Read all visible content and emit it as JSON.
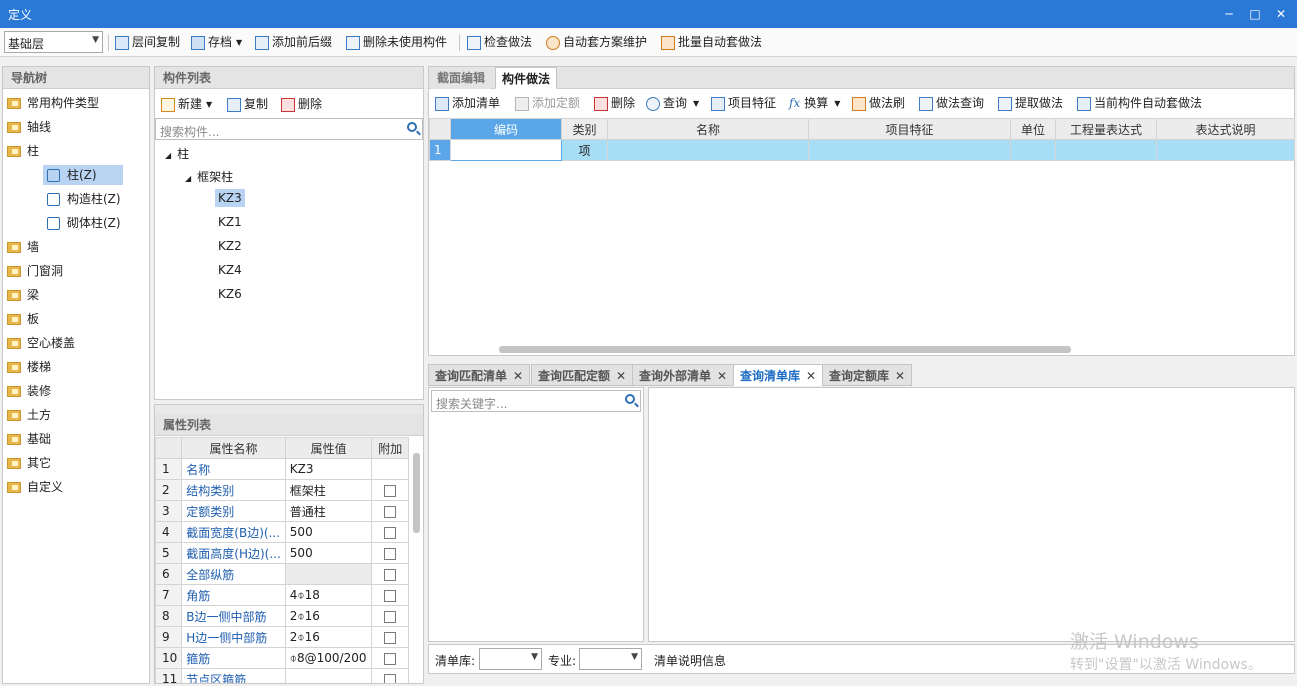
{
  "window": {
    "title": "定义",
    "min": "─",
    "max": "□",
    "close": "✕"
  },
  "toolbar": {
    "layer_value": "基础层",
    "buttons": [
      "层间复制",
      "存档",
      "添加前后缀",
      "删除未使用构件",
      "检查做法",
      "自动套方案维护",
      "批量自动套做法"
    ]
  },
  "nav": {
    "title": "导航树",
    "items": [
      "常用构件类型",
      "轴线",
      "柱",
      "墙",
      "门窗洞",
      "梁",
      "板",
      "空心楼盖",
      "楼梯",
      "装修",
      "土方",
      "基础",
      "其它",
      "自定义"
    ],
    "sub_items": [
      "柱(Z)",
      "构造柱(Z)",
      "砌体柱(Z)"
    ]
  },
  "component_list": {
    "title": "构件列表",
    "new_label": "新建",
    "copy_label": "复制",
    "delete_label": "删除",
    "search_placeholder": "搜索构件...",
    "tree_root": "柱",
    "tree_group": "框架柱",
    "tree_items": [
      "KZ3",
      "KZ1",
      "KZ2",
      "KZ4",
      "KZ6"
    ]
  },
  "property_list": {
    "title": "属性列表",
    "headers": [
      "属性名称",
      "属性值",
      "附加"
    ],
    "rows": [
      {
        "idx": "1",
        "name": "名称",
        "value": "KZ3"
      },
      {
        "idx": "2",
        "name": "结构类别",
        "value": "框架柱"
      },
      {
        "idx": "3",
        "name": "定额类别",
        "value": "普通柱"
      },
      {
        "idx": "4",
        "name": "截面宽度(B边)(...",
        "value": "500"
      },
      {
        "idx": "5",
        "name": "截面高度(H边)(...",
        "value": "500"
      },
      {
        "idx": "6",
        "name": "全部纵筋",
        "value": ""
      },
      {
        "idx": "7",
        "name": "角筋",
        "value": "4⌽18"
      },
      {
        "idx": "8",
        "name": "B边一侧中部筋",
        "value": "2⌽16"
      },
      {
        "idx": "9",
        "name": "H边一侧中部筋",
        "value": "2⌽16"
      },
      {
        "idx": "10",
        "name": "箍筋",
        "value": "⌽8@100/200"
      },
      {
        "idx": "11",
        "name": "节点区箍筋",
        "value": ""
      }
    ]
  },
  "right_tabs": [
    "截面编辑",
    "构件做法"
  ],
  "method_toolbar": [
    "添加清单",
    "添加定额",
    "删除",
    "查询",
    "项目特征",
    "换算",
    "做法刷",
    "做法查询",
    "提取做法",
    "当前构件自动套做法"
  ],
  "method_grid": {
    "headers": [
      "编码",
      "类别",
      "名称",
      "项目特征",
      "单位",
      "工程量表达式",
      "表达式说明"
    ],
    "row": {
      "idx": "1",
      "code": "",
      "type": "项"
    }
  },
  "query_tabs": [
    "查询匹配清单",
    "查询匹配定额",
    "查询外部清单",
    "查询清单库",
    "查询定额库"
  ],
  "query": {
    "search_placeholder": "搜索关键字...",
    "lib_label": "清单库:",
    "major_label": "专业:",
    "info_label": "清单说明信息"
  },
  "watermark": {
    "line1": "激活 Windows",
    "line2": "转到\"设置\"以激活 Windows。"
  }
}
